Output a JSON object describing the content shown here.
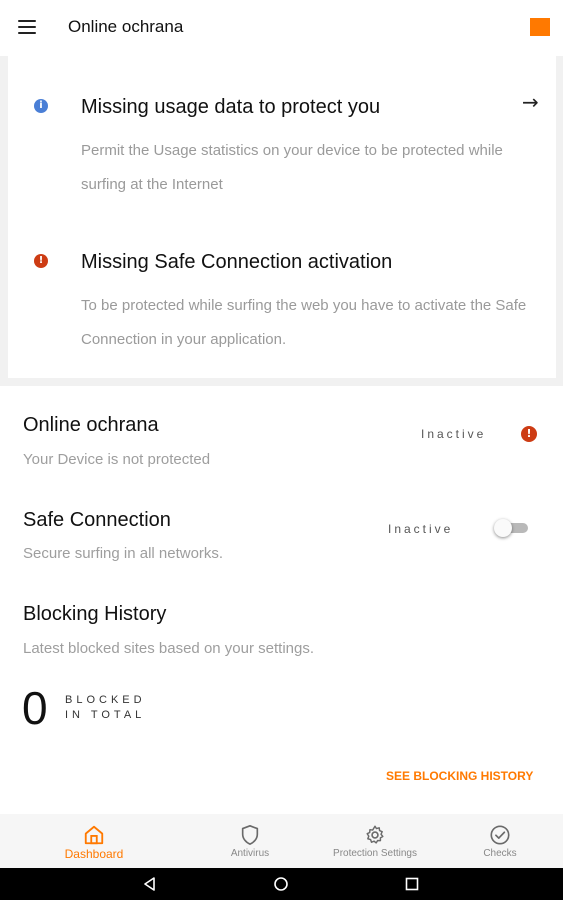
{
  "header": {
    "title": "Online ochrana",
    "menu_icon": "hamburger-menu-icon",
    "logo": "orange-logo",
    "brand_color": "#ff7900"
  },
  "alerts": [
    {
      "icon": "info-icon",
      "icon_color": "#4a7fd6",
      "title": "Missing usage data to protect you",
      "text": "Permit the Usage statistics on your device to be protected while surfing at the Internet",
      "action_icon": "arrow-right-icon"
    },
    {
      "icon": "error-icon",
      "icon_color": "#cd3c14",
      "title": "Missing Safe Connection activation",
      "text": "To be protected while surfing the web you have to activate the Safe Connection in your application."
    }
  ],
  "online_protection": {
    "title": "Online ochrana",
    "subtitle": "Your Device is not protected",
    "status": "Inactive",
    "status_icon": "warning-icon"
  },
  "safe_connection": {
    "title": "Safe Connection",
    "subtitle": "Secure surfing in all networks.",
    "status": "Inactive",
    "toggle_on": false
  },
  "blocking_history": {
    "title": "Blocking History",
    "subtitle": "Latest blocked sites based on your settings.",
    "count": "0",
    "label_line1": "BLOCKED",
    "label_line2": "IN TOTAL",
    "link": "SEE BLOCKING HISTORY"
  },
  "bottom_nav": [
    {
      "label": "Dashboard",
      "icon": "home-icon",
      "active": true
    },
    {
      "label": "Antivirus",
      "icon": "shield-icon",
      "active": false
    },
    {
      "label": "Protection Settings",
      "icon": "gear-icon",
      "active": false
    },
    {
      "label": "Checks",
      "icon": "check-circle-icon",
      "active": false
    }
  ],
  "system_nav": [
    "back-icon",
    "home-circle-icon",
    "recents-icon"
  ]
}
